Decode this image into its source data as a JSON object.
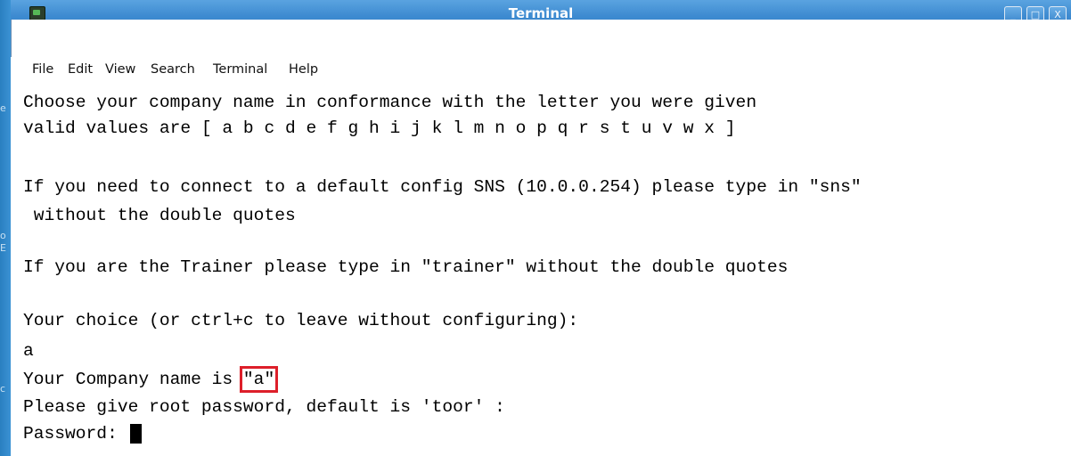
{
  "window": {
    "title": "Terminal",
    "buttons": [
      {
        "name": "minimize-button",
        "glyph": "_"
      },
      {
        "name": "maximize-button",
        "glyph": "□"
      },
      {
        "name": "close-button",
        "glyph": "X"
      }
    ]
  },
  "menubar": {
    "items": [
      "File",
      "Edit",
      "View",
      "Search",
      "Terminal",
      "Help"
    ]
  },
  "terminal": {
    "lines": [
      "Choose your company name in conformance with the letter you were given",
      "valid values are [ a b c d e f g h i j k l m n o p q r s t u v w x ]",
      "",
      "If you need to connect to a default config SNS (10.0.0.254) please type in \"sns\"",
      " without the double quotes",
      "",
      "If you are the Trainer please type in \"trainer\" without the double quotes",
      "",
      "Your choice (or ctrl+c to leave without configuring):",
      "a"
    ],
    "company_prefix": "Your Company name is ",
    "company_value": "\"a\"",
    "password_prompt_line": "Please give root password, default is 'toor' :",
    "password_label": "Password: "
  },
  "colors": {
    "titlebar": "#3d8ad0",
    "highlight_box": "#dd1f2a",
    "terminal_bg": "#ffffff"
  }
}
